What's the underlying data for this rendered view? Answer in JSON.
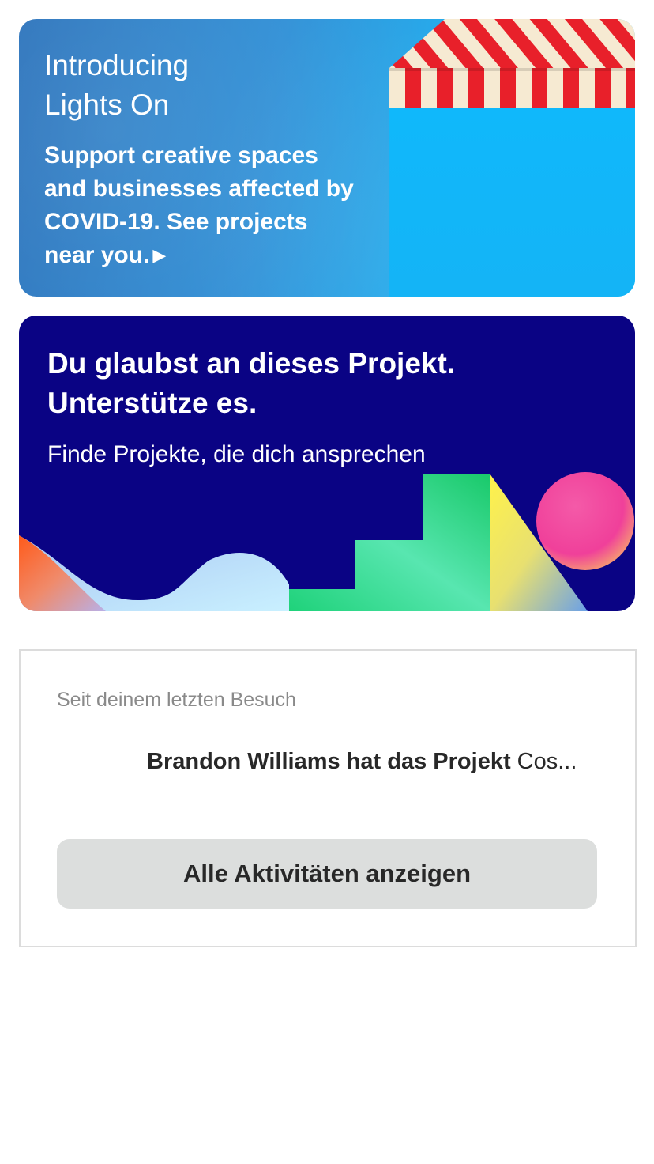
{
  "lights_on_card": {
    "title_line1": "Introducing",
    "title_line2": "Lights On",
    "description": "Support creative spaces and businesses affected by COVID-19. See projects near you.",
    "arrow_glyph": "▶",
    "colors": {
      "gradient_start": "#2a72bb",
      "gradient_end": "#12bdfb",
      "awning_red": "#e8202a",
      "awning_cream": "#f6ead2"
    },
    "icon": "awning-illustration"
  },
  "projects_card": {
    "title_line1": "Du glaubst an dieses Projekt.",
    "title_line2": "Unterstütze es.",
    "subtitle": "Finde Projekte, die dich ansprechen",
    "colors": {
      "background": "#0a0384"
    },
    "icon": "abstract-shapes-illustration"
  },
  "activity": {
    "heading": "Seit deinem letzten Besuch",
    "items": [
      {
        "actor_text": "Brandon Williams hat das Projekt",
        "project_text": " Cos..."
      }
    ],
    "button_label": "Alle Aktivitäten anzeigen",
    "colors": {
      "button_bg": "#dcdedd",
      "border": "#dcdcdc"
    }
  }
}
